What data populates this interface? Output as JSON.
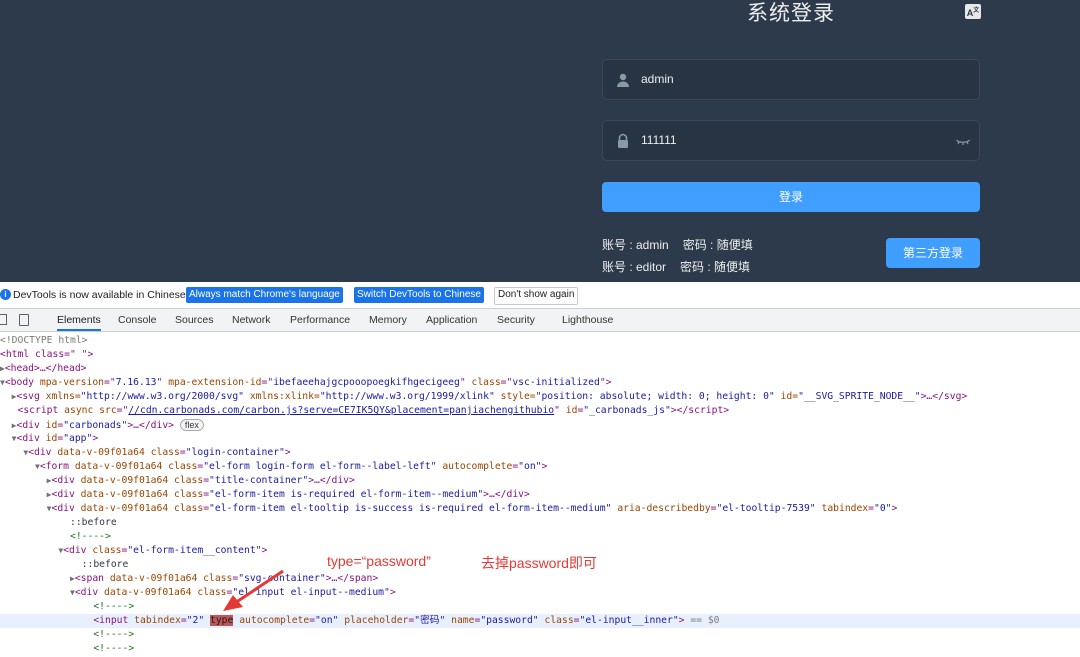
{
  "login": {
    "title": "系统登录",
    "lang_icon": "translate-icon",
    "username": {
      "value": "admin",
      "icon": "user-icon"
    },
    "password": {
      "value": "111111",
      "icon": "lock-icon",
      "toggle_icon": "eye-closed-icon"
    },
    "login_button": "登录",
    "tips": [
      {
        "account": "账号 : admin",
        "password": "密码 : 随便填"
      },
      {
        "account": "账号 : editor",
        "password": "密码 : 随便填"
      }
    ],
    "third_party_button": "第三方登录",
    "colors": {
      "background": "#2d3a4b",
      "accent": "#409eff"
    }
  },
  "devtools": {
    "notice": {
      "message": "DevTools is now available in Chinese!",
      "btn_match": "Always match Chrome's language",
      "btn_switch": "Switch DevTools to Chinese",
      "btn_dismiss": "Don't show again"
    },
    "tabs": [
      "Elements",
      "Console",
      "Sources",
      "Network",
      "Performance",
      "Memory",
      "Application",
      "Security",
      "Lighthouse"
    ],
    "active_tab": "Elements",
    "dom": {
      "doctype": "<!DOCTYPE html>",
      "html_open": "<html class=\" \">",
      "head": "<head>…</head>",
      "body_tag": "body",
      "body_attrs": [
        {
          "n": "mpa-version",
          "v": "7.16.13"
        },
        {
          "n": "mpa-extension-id",
          "v": "ibefaeehajgcpooopoegkifhgecigeeg"
        },
        {
          "n": "class",
          "v": "vsc-initialized"
        }
      ],
      "svg_line_a": "xmlns=",
      "svg_xmlns": "\"http://www.w3.org/2000/svg\"",
      "svg_xlink_n": " xmlns:xlink=",
      "svg_xlink": "\"http://www.w3.org/1999/xlink\"",
      "svg_style_n": " style=",
      "svg_style": "\"position: absolute; width: 0; height: 0\"",
      "svg_id_n": " id=",
      "svg_id": "\"__SVG_SPRITE_NODE__\"",
      "script_src_url": "//cdn.carbonads.com/carbon.js?serve=CE7IK5QY&placement=panjiachengithubio",
      "script_id": "\"_carbonads_js\"",
      "carbonads_id": "\"carbonads\"",
      "flex_badge": "flex",
      "app_id": "\"app\"",
      "scope_attr": "data-v-09f01a64",
      "login_container": "\"login-container\"",
      "form_class": "\"el-form login-form el-form--label-left\"",
      "form_autocomplete": "\"on\"",
      "title_container": "\"title-container\"",
      "form_item_1": "\"el-form-item is-required el-form-item--medium\"",
      "form_item_2": "\"el-form-item el-tooltip is-success is-required el-form-item--medium\"",
      "aria_describedby": "\"el-tooltip-7539\"",
      "tabindex_0": "\"0\"",
      "before": "::before",
      "comment": "<!---->",
      "item_content": "\"el-form-item__content\"",
      "span_class": "\"svg-container\"",
      "input_div_class": "\"el-input el-input--medium\"",
      "input_tabindex": "\"2\"",
      "input_type_attr": "type",
      "input_autocomplete": "\"on\"",
      "input_placeholder": "\"密码\"",
      "input_name": "\"password\"",
      "input_class": "\"el-input__inner\"",
      "selected_marker": "== $0"
    }
  },
  "annotations": {
    "note1": "type=“password”",
    "note2": "去掉password即可",
    "arrow_color": "#e53935"
  }
}
